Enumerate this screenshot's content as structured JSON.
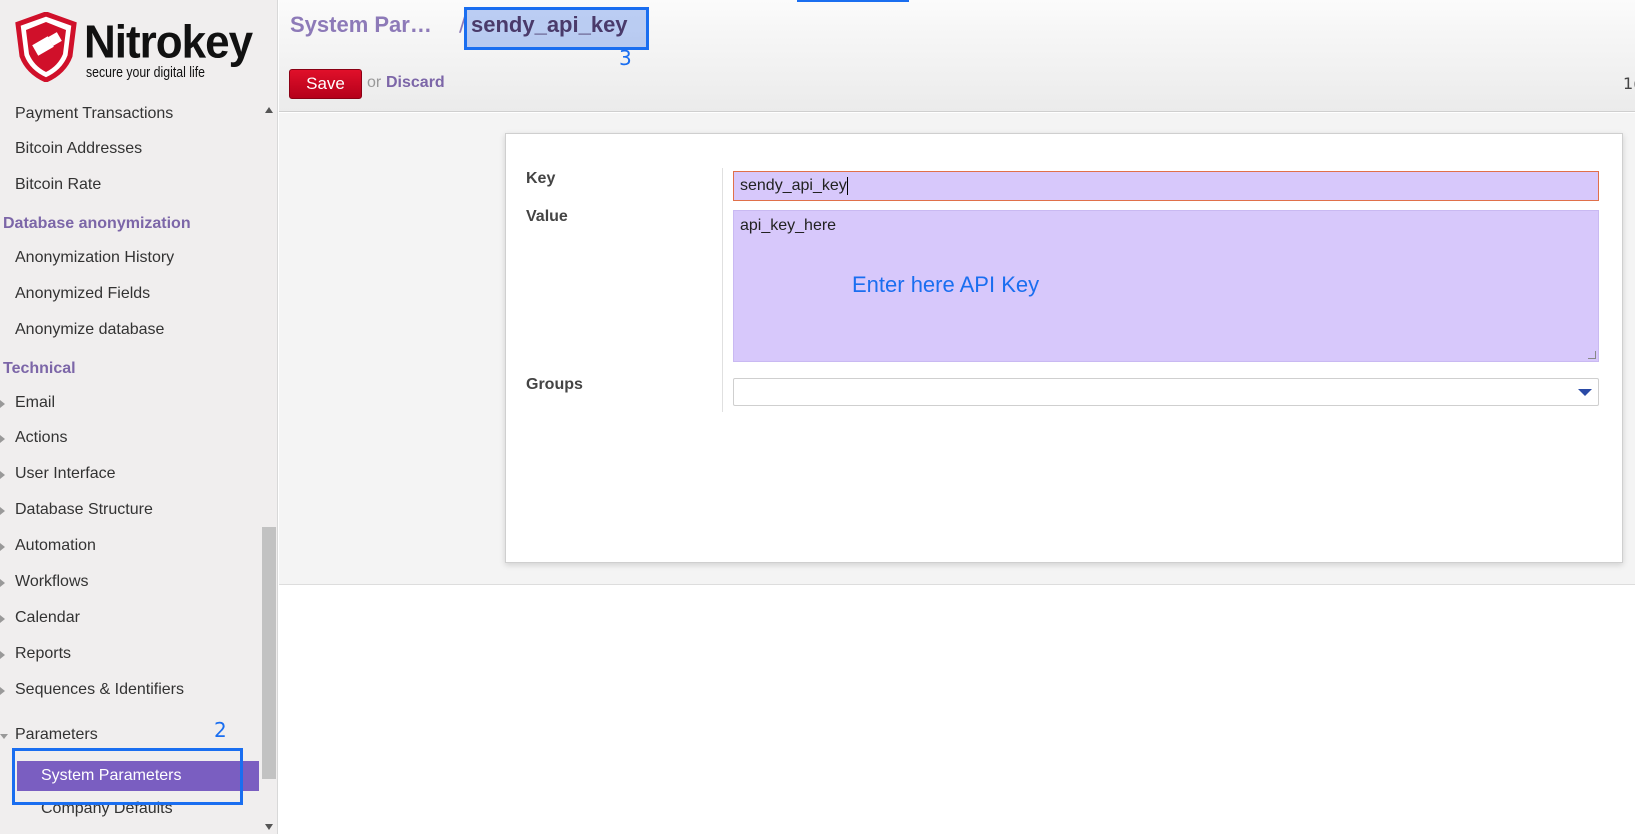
{
  "brand": {
    "name": "Nitrokey",
    "tagline": "secure your digital life"
  },
  "sidebar": {
    "items_top": [
      {
        "label": "Payment Transactions"
      },
      {
        "label": "Bitcoin Addresses"
      },
      {
        "label": "Bitcoin Rate"
      }
    ],
    "section_db": "Database anonymization",
    "items_db": [
      {
        "label": "Anonymization History"
      },
      {
        "label": "Anonymized Fields"
      },
      {
        "label": "Anonymize database"
      }
    ],
    "section_tech": "Technical",
    "items_tech": [
      {
        "label": "Email"
      },
      {
        "label": "Actions"
      },
      {
        "label": "User Interface"
      },
      {
        "label": "Database Structure"
      },
      {
        "label": "Automation"
      },
      {
        "label": "Workflows"
      },
      {
        "label": "Calendar"
      },
      {
        "label": "Reports"
      },
      {
        "label": "Sequences & Identifiers"
      },
      {
        "label": "Parameters"
      }
    ],
    "active_item": "System Parameters",
    "after_active": "Company Defaults"
  },
  "breadcrumb": {
    "parent": "System Par…",
    "separator": "/",
    "current": "sendy_api_key"
  },
  "toolbar": {
    "save_label": "Save",
    "or_text": "or",
    "discard_label": "Discard",
    "pager": "1("
  },
  "form": {
    "key_label": "Key",
    "key_value": "sendy_api_key",
    "value_label": "Value",
    "value_value": "api_key_here",
    "groups_label": "Groups"
  },
  "annotations": {
    "step2": "2",
    "step3": "3",
    "value_hint": "Enter here API Key"
  },
  "colors": {
    "accent": "#7c66a8",
    "active_bg": "#7a5ec1",
    "save_red": "#d00020",
    "annotation_blue": "#1a6ef0",
    "field_bg": "#d7c8fb"
  }
}
